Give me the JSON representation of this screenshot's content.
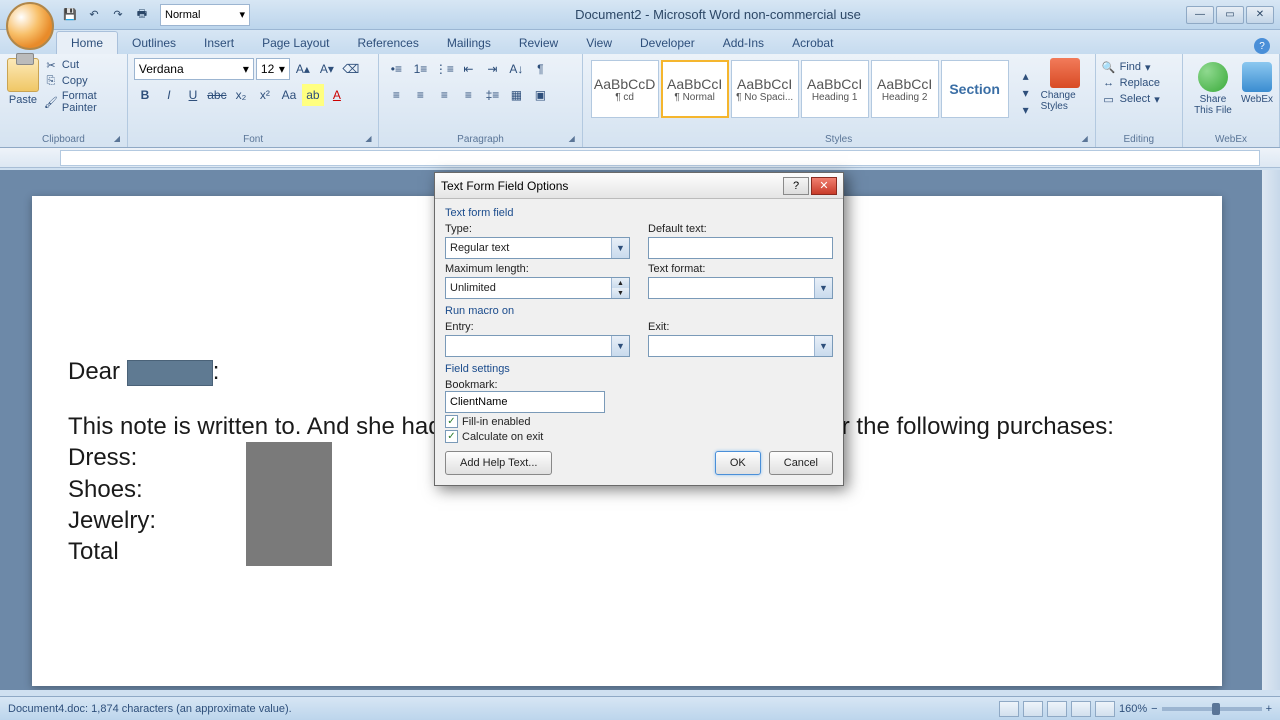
{
  "window": {
    "title": "Document2 - Microsoft Word non-commercial use"
  },
  "ribbon": {
    "tabs": [
      "Home",
      "Outlines",
      "Insert",
      "Page Layout",
      "References",
      "Mailings",
      "Review",
      "View",
      "Developer",
      "Add-Ins",
      "Acrobat"
    ],
    "active_tab": "Home",
    "clipboard": {
      "label": "Clipboard",
      "paste": "Paste",
      "cut": "Cut",
      "copy": "Copy",
      "fmt": "Format Painter"
    },
    "font": {
      "label": "Font",
      "name": "Verdana",
      "size": "12"
    },
    "paragraph": {
      "label": "Paragraph"
    },
    "styles": {
      "label": "Styles",
      "tiles": [
        {
          "preview": "AaBbCcD",
          "name": "¶ cd"
        },
        {
          "preview": "AaBbCcI",
          "name": "¶ Normal"
        },
        {
          "preview": "AaBbCcI",
          "name": "¶ No Spaci..."
        },
        {
          "preview": "AaBbCcI",
          "name": "Heading 1"
        },
        {
          "preview": "AaBbCcI",
          "name": "Heading 2"
        },
        {
          "preview": "Section",
          "name": ""
        }
      ],
      "change": "Change Styles"
    },
    "editing": {
      "label": "Editing",
      "find": "Find",
      "replace": "Replace",
      "select": "Select"
    },
    "webex": {
      "label": "WebEx",
      "share": "Share This File",
      "webex": "WebEx"
    }
  },
  "document": {
    "dear": "Dear",
    "colon": ":",
    "body1": "This note is written to.  And she had better reply!  Because she owes us for the following purchases:",
    "dress": "Dress:",
    "shoes": "Shoes:",
    "jewelry": "Jewelry:",
    "total": "Total"
  },
  "dialog": {
    "title": "Text Form Field Options",
    "sect_field": "Text form field",
    "type_lbl": "Type:",
    "type_val": "Regular text",
    "default_lbl": "Default text:",
    "default_val": "",
    "maxlen_lbl": "Maximum length:",
    "maxlen_val": "Unlimited",
    "fmt_lbl": "Text format:",
    "fmt_val": "",
    "sect_macro": "Run macro on",
    "entry_lbl": "Entry:",
    "exit_lbl": "Exit:",
    "sect_settings": "Field settings",
    "bookmark_lbl": "Bookmark:",
    "bookmark_val": "ClientName",
    "fillin": "Fill-in enabled",
    "calc": "Calculate on exit",
    "help_btn": "Add Help Text...",
    "ok": "OK",
    "cancel": "Cancel"
  },
  "status": {
    "doc": "Document4.doc: 1,874 characters (an approximate value).",
    "zoom": "160%"
  }
}
